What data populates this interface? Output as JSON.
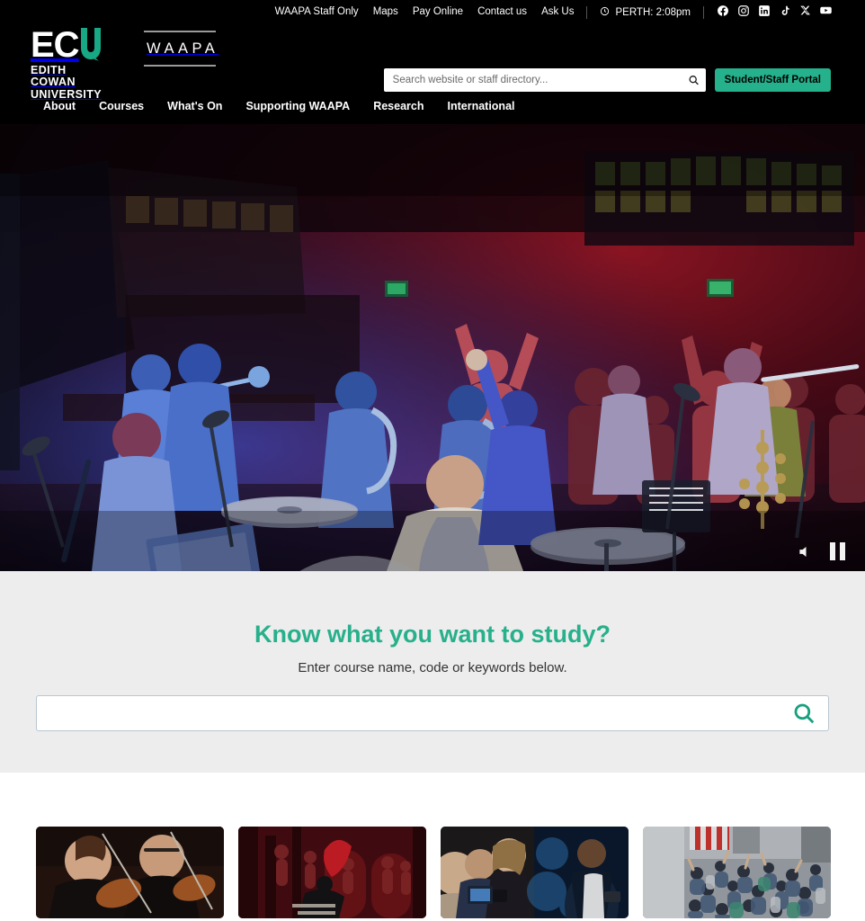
{
  "header": {
    "utility": {
      "links": [
        {
          "label": "WAAPA Staff Only"
        },
        {
          "label": "Maps"
        },
        {
          "label": "Pay Online"
        },
        {
          "label": "Contact us"
        },
        {
          "label": "Ask Us"
        }
      ],
      "clock": {
        "icon": "clock-icon",
        "label": "PERTH: 2:08pm"
      },
      "socials": [
        {
          "name": "facebook-icon"
        },
        {
          "name": "instagram-icon"
        },
        {
          "name": "linkedin-icon"
        },
        {
          "name": "tiktok-icon"
        },
        {
          "name": "x-twitter-icon"
        },
        {
          "name": "youtube-icon"
        }
      ]
    },
    "logo": {
      "mark_ec": "EC",
      "mark_u": "U",
      "sub_line1": "EDITH COWAN",
      "sub_line2": "UNIVERSITY",
      "partner": "WAAPA"
    },
    "search": {
      "placeholder": "Search website or staff directory...",
      "value": "",
      "icon": "search-icon"
    },
    "portal_button": {
      "label": "Student/Staff Portal"
    },
    "nav": [
      {
        "label": "About"
      },
      {
        "label": "Courses"
      },
      {
        "label": "What's On"
      },
      {
        "label": "Supporting WAAPA"
      },
      {
        "label": "Research"
      },
      {
        "label": "International"
      }
    ]
  },
  "hero": {
    "controls": {
      "mute": {
        "name": "volume-mute-icon"
      },
      "pause": {
        "name": "pause-icon"
      }
    }
  },
  "study": {
    "title": "Know what you want to study?",
    "subtitle": "Enter course name, code or keywords below.",
    "input": {
      "value": "",
      "placeholder": ""
    },
    "search_icon": "search-icon"
  },
  "cards": [
    {
      "name": "card-music-violin"
    },
    {
      "name": "card-musical-theatre"
    },
    {
      "name": "card-screen-media"
    },
    {
      "name": "card-community-group"
    }
  ],
  "colors": {
    "accent_green": "#25b18c",
    "heading_green": "#27b08b",
    "header_black": "#000000",
    "study_bg": "#ededed"
  }
}
